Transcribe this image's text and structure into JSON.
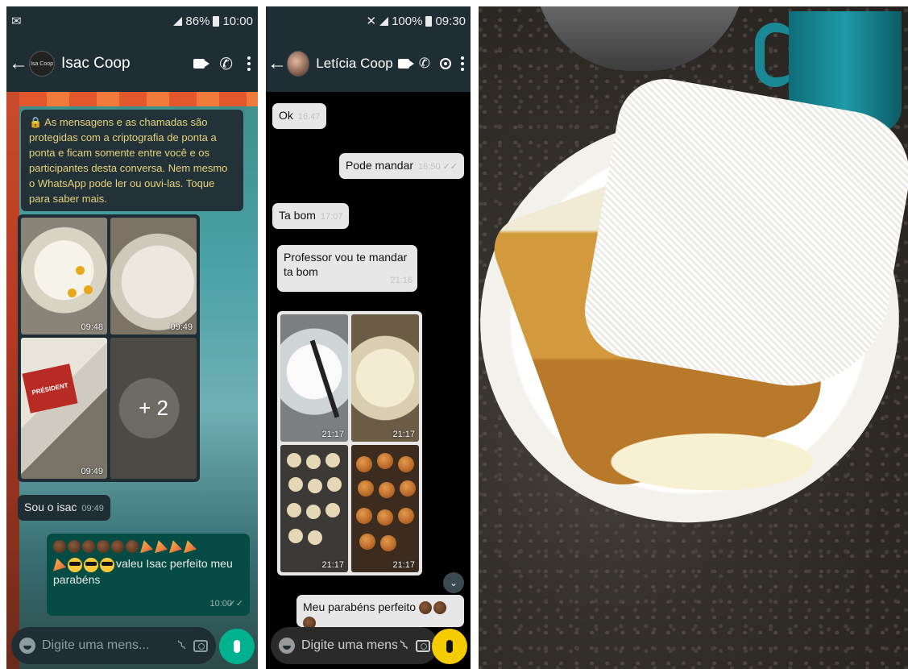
{
  "panel1": {
    "status": {
      "time": "10:00",
      "battery": "86%"
    },
    "header": {
      "avatar_text": "Isa Coop",
      "title": "Isac Coop"
    },
    "encryption_notice": "🔒 As mensagens e as chamadas são protegidas com a criptografia de ponta a ponta e ficam somente entre você e os participantes desta conversa. Nem mesmo o WhatsApp pode ler ou ouvi-las. Toque para saber mais.",
    "image_grid": {
      "timestamps": [
        "09:48",
        "09:49",
        "09:49"
      ],
      "more_label": "+ 2",
      "package_text": "PRÉSIDENT"
    },
    "messages": [
      {
        "text": "Sou o isac",
        "time": "09:49"
      },
      {
        "text": "valeu Isac perfeito meu parabéns",
        "time": "10:00"
      }
    ],
    "input": {
      "placeholder": "Digite uma mens..."
    }
  },
  "panel2": {
    "status": {
      "time": "09:30",
      "battery": "100%"
    },
    "header": {
      "title": "Letícia Coop"
    },
    "messages": [
      {
        "text": "Ok",
        "time": "16:47"
      },
      {
        "text": "Pode mandar",
        "time": "16:50"
      },
      {
        "text": "Ta bom",
        "time": "17:07"
      },
      {
        "text": "Professor vou te mandar ta bom",
        "time": "21:16"
      },
      {
        "text": "Meu parabéns perfeito"
      }
    ],
    "image_grid": {
      "timestamps": [
        "21:17",
        "21:17",
        "21:17",
        "21:17"
      ]
    },
    "input": {
      "placeholder": "Digite uma mens..."
    }
  },
  "icons": {
    "back": "arrow-left",
    "video": "video-camera",
    "call": "phone",
    "menu": "vertical-dots",
    "location": "target",
    "emoji": "smiley",
    "attach": "paperclip",
    "camera": "camera",
    "mic": "microphone"
  },
  "colors": {
    "header": "#1f2e35",
    "outgoing_bubble_p1": "#054d44",
    "mic_p1": "#00b28f",
    "mic_p2": "#f5cc00",
    "encryption_text": "#e8d27a"
  }
}
